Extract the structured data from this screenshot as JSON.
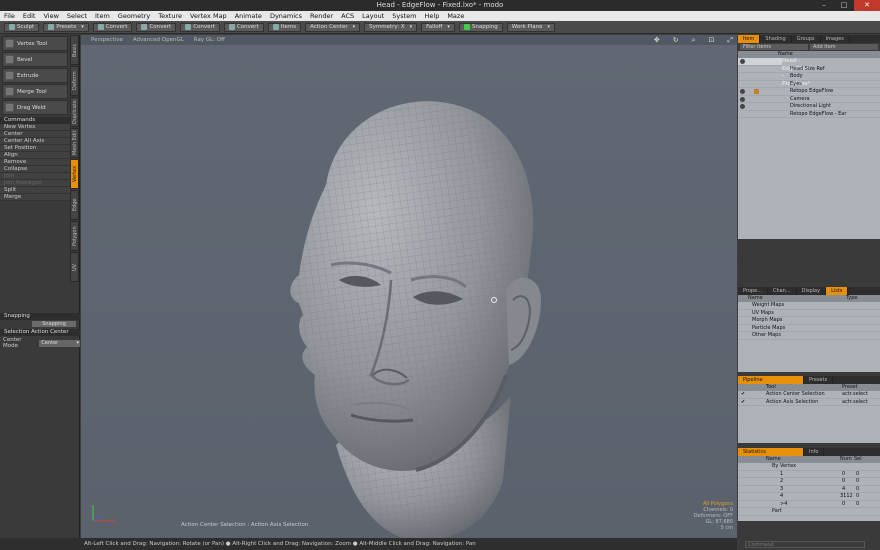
{
  "window": {
    "title": "Head - EdgeFlow - Fixed.lxo* - modo",
    "buttons": [
      "–",
      "□",
      "✕"
    ]
  },
  "menubar": [
    "File",
    "Edit",
    "View",
    "Select",
    "Item",
    "Geometry",
    "Texture",
    "Vertex Map",
    "Animate",
    "Dynamics",
    "Render",
    "ACS",
    "Layout",
    "System",
    "Help",
    "Maze"
  ],
  "toolbar": {
    "sculpt": "Sculpt",
    "presets": "Presets",
    "convert": "Convert",
    "items": "Items",
    "action_center": "Action Center",
    "symmetry": "Symmetry: X",
    "falloff": "Falloff",
    "snapping": "Snapping",
    "work_plane": "Work Plane"
  },
  "left_tools": [
    "Vertex Tool",
    "Bevel",
    "Extrude",
    "Merge Tool",
    "Drag Weld"
  ],
  "left_vtabs": [
    "Basic",
    "Deform",
    "Duplicate",
    "Mesh Edit",
    "Vertex",
    "Edge",
    "Polygon",
    "UV"
  ],
  "commands": {
    "header": "Commands",
    "items": [
      {
        "label": "New Vertex",
        "enabled": true
      },
      {
        "label": "Center",
        "enabled": true
      },
      {
        "label": "Center All Axis",
        "enabled": true
      },
      {
        "label": "Set Position",
        "enabled": true
      },
      {
        "label": "Align",
        "enabled": true
      },
      {
        "label": "Remove",
        "enabled": true
      },
      {
        "label": "Collapse",
        "enabled": true
      },
      {
        "label": "Join",
        "enabled": false
      },
      {
        "label": "Join Averaged",
        "enabled": false
      },
      {
        "label": "Split",
        "enabled": true
      },
      {
        "label": "Merge",
        "enabled": true
      }
    ]
  },
  "snapping_section": {
    "header": "Snapping",
    "button": "Snapping",
    "sel_header": "Selection Action Center",
    "center_mode_label": "Center Mode",
    "center_mode_value": "Center"
  },
  "viewport": {
    "tabs": [
      "Perspective",
      "Advanced OpenGL",
      "Ray GL: Off"
    ],
    "info": [
      "All Polygons",
      "Channels: 0",
      "Deformers: OFF",
      "GL: 87,680",
      "5 cm"
    ],
    "status": "Action Center Selection : Action Axis Selection"
  },
  "item_list": {
    "tabs": [
      "Item",
      "Shading",
      "Groups",
      "Images"
    ],
    "filter": "Filter Items",
    "add": "Add Item",
    "col_name": "Name",
    "rows": [
      {
        "label": "Head - EdgeFlow - Fixed.lxo*",
        "indent": 0,
        "eye": true
      },
      {
        "label": "Head Size Ref",
        "indent": 1,
        "eye": false
      },
      {
        "label": "Body",
        "indent": 1,
        "eye": false
      },
      {
        "label": "Eyes",
        "indent": 1,
        "eye": false
      },
      {
        "label": "Retopo EdgeFlow",
        "indent": 1,
        "eye": true
      },
      {
        "label": "Camera",
        "indent": 1,
        "eye": true
      },
      {
        "label": "Directional Light",
        "indent": 1,
        "eye": true
      },
      {
        "label": "Retopo EdgeFlow - Ear",
        "indent": 1,
        "eye": false
      }
    ]
  },
  "maps_panel": {
    "tabs": [
      "Prope...",
      "Chan...",
      "Display",
      "Lists"
    ],
    "col_name": "Name",
    "col_type": "Type",
    "rows": [
      "Weight Maps",
      "UV Maps",
      "Morph Maps",
      "Particle Maps",
      "Other Maps"
    ]
  },
  "pipeline": {
    "tabs": [
      "Pipeline",
      "Presets"
    ],
    "cols": [
      "Tool",
      "Preset"
    ],
    "rows": [
      {
        "tool": "Action Center Selection",
        "preset": "actr.select"
      },
      {
        "tool": "Action Axis Selection",
        "preset": "actr.select"
      }
    ]
  },
  "statistics": {
    "tabs": [
      "Statistics",
      "Info"
    ],
    "cols": [
      "Name",
      "Num",
      "Sel"
    ],
    "rows": [
      {
        "name": "By Vertex",
        "num": "",
        "sel": ""
      },
      {
        "name": "1",
        "num": "0",
        "sel": "0"
      },
      {
        "name": "2",
        "num": "0",
        "sel": "0"
      },
      {
        "name": "3",
        "num": "4",
        "sel": "0"
      },
      {
        "name": "4",
        "num": "3112",
        "sel": "0"
      },
      {
        "name": ">4",
        "num": "0",
        "sel": "0"
      },
      {
        "name": "Part",
        "num": "",
        "sel": ""
      }
    ]
  },
  "command_hint": "Alt-Left Click and Drag: Navigation: Rotate (or Pan) ● Alt-Right Click and Drag: Navigation: Zoom ● Alt-Middle Click and Drag: Navigation: Pan",
  "command_input_placeholder": "Command",
  "colors": {
    "accent": "#e8900a",
    "viewport_bg": "#5f6670",
    "mesh": "#9a9ea4"
  }
}
